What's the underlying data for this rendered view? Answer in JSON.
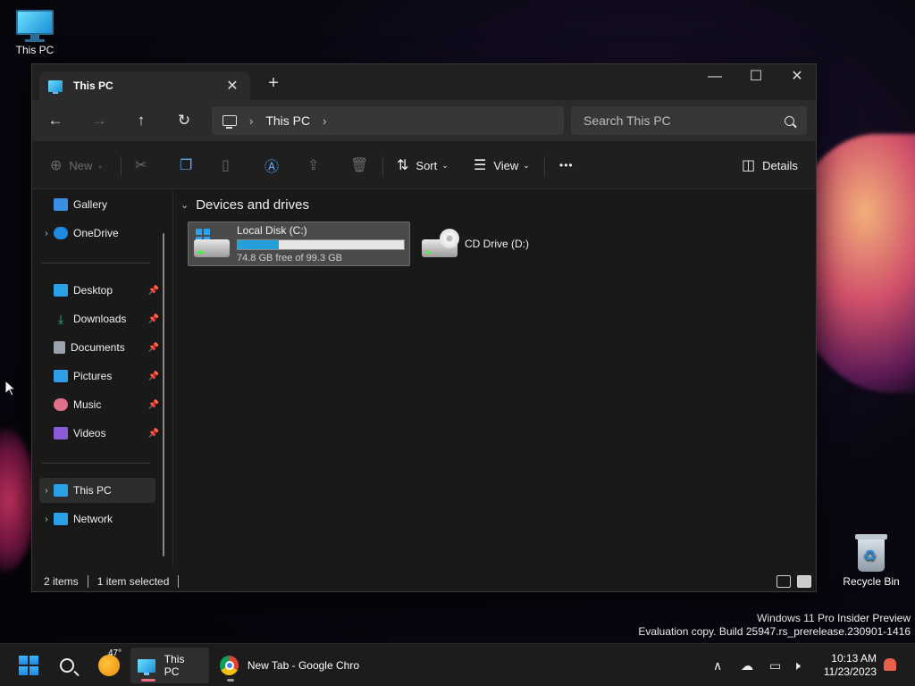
{
  "desktop": {
    "icons": [
      {
        "label": "This PC"
      },
      {
        "label": "Recycle Bin"
      }
    ],
    "watermark": {
      "line1": "Windows 11 Pro Insider Preview",
      "line2": "Evaluation copy. Build 25947.rs_prerelease.230901-1416"
    }
  },
  "window": {
    "tab_title": "This PC",
    "tab_close": "✕",
    "new_tab": "+",
    "controls": {
      "minimize": "—",
      "maximize": "☐",
      "close": "✕"
    },
    "nav": {
      "back": "←",
      "forward": "→",
      "up": "↑",
      "refresh": "↻"
    },
    "breadcrumb": [
      "This PC"
    ],
    "search_placeholder": "Search This PC",
    "commands": {
      "new": "New",
      "sort": "Sort",
      "view": "View",
      "more": "•••",
      "details": "Details"
    },
    "sidebar": {
      "top": [
        {
          "label": "Gallery",
          "icon": "gallery-icon",
          "color": "#3a8ee6"
        },
        {
          "label": "OneDrive",
          "icon": "onedrive-icon",
          "color": "#1f8be0"
        }
      ],
      "quick": [
        {
          "label": "Desktop",
          "icon": "desktop-icon",
          "color": "#2aa1e6"
        },
        {
          "label": "Downloads",
          "icon": "downloads-icon",
          "color": "#2dbd6e"
        },
        {
          "label": "Documents",
          "icon": "documents-icon",
          "color": "#9aa3ad"
        },
        {
          "label": "Pictures",
          "icon": "pictures-icon",
          "color": "#2f9ee6"
        },
        {
          "label": "Music",
          "icon": "music-icon",
          "color": "#e0708a"
        },
        {
          "label": "Videos",
          "icon": "videos-icon",
          "color": "#8a5cd6"
        }
      ],
      "bottom": [
        {
          "label": "This PC",
          "icon": "this-pc-icon",
          "color": "#2aa1e6"
        },
        {
          "label": "Network",
          "icon": "network-icon",
          "color": "#2aa1e6"
        }
      ]
    },
    "group_header": "Devices and drives",
    "drives": [
      {
        "name": "Local Disk (C:)",
        "free_text": "74.8 GB free of 99.3 GB",
        "used_fraction": 0.247
      },
      {
        "name": "CD Drive (D:)"
      }
    ],
    "status": {
      "items": "2 items",
      "selected": "1 item selected"
    }
  },
  "taskbar": {
    "weather_temp": "47°",
    "apps": [
      {
        "label": "This PC"
      },
      {
        "label": "New Tab - Google Chro"
      }
    ],
    "clock": {
      "time": "10:13 AM",
      "date": "11/23/2023"
    }
  }
}
